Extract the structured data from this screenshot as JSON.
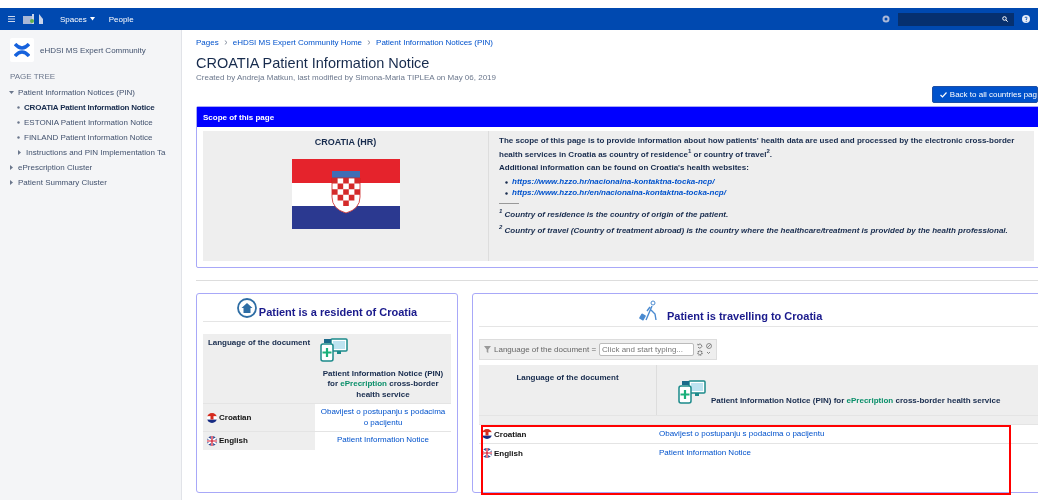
{
  "top_bar": {
    "nav": [
      {
        "label": "Spaces",
        "kind": "dropdown"
      },
      {
        "label": "People",
        "kind": "link"
      }
    ]
  },
  "sidebar": {
    "space_name": "eHDSI MS Expert Community",
    "section_title": "PAGE TREE",
    "tree": [
      {
        "label": "Patient Information Notices (PIN)",
        "kind": "folder",
        "expanded": true,
        "selected": false,
        "children": [
          {
            "label": "CROATIA Patient Information Notice",
            "kind": "page",
            "selected": true
          },
          {
            "label": "ESTONIA Patient Information Notice",
            "kind": "page",
            "selected": false
          },
          {
            "label": "FINLAND Patient Information Notice",
            "kind": "page",
            "selected": false
          },
          {
            "label": "Instructions and PIN Implementation Ta",
            "kind": "folder",
            "expanded": false,
            "selected": false
          }
        ]
      },
      {
        "label": "ePrescription Cluster",
        "kind": "folder",
        "expanded": false,
        "selected": false
      },
      {
        "label": "Patient Summary Cluster",
        "kind": "folder",
        "expanded": false,
        "selected": false
      }
    ]
  },
  "breadcrumbs": [
    "Pages",
    "eHDSI MS Expert Community Home",
    "Patient Information Notices (PIN)"
  ],
  "page_title": "CROATIA Patient Information Notice",
  "byline": "Created by Andreja Matkun, last modified by Simona-Maria TIPLEA on May 06, 2019",
  "back_button": "Back to all countries pag",
  "scope": {
    "header": "Scope of this page",
    "country": "CROATIA (HR)",
    "intro": "The scope of this page is to provide information about how patients' health data are used and processed by the electronic cross-border health services in Croatia as country of residence$^{1}$ or country of travel$^{2}$.",
    "links_heading": "Additional information can be found on Croatia's health websites:",
    "links": [
      "https://www.hzzo.hr/nacionalna-kontaktna-tocka-ncp/",
      "https://www.hzzo.hr/en/nacionalna-kontaktna-tocka-ncp/"
    ],
    "footnotes": [
      "$^{1}$ **Country of residence is the country of origin of the patient.**",
      "$^{2}$ **Country of travel** (Country of treatment abroad) is the country where the healthcare/treatment is provided by the health professional."
    ]
  },
  "resident": {
    "title": "Patient is a resident of Croatia",
    "column_1": "Language of the document",
    "pin_heading": [
      {
        "text": "Patient Information Notice (PIN) for ",
        "kind": "plain"
      },
      {
        "text": "ePrecription",
        "kind": "highlight"
      },
      {
        "text": " cross-border health service",
        "kind": "plain"
      }
    ],
    "rows": [
      {
        "language": "Croatian",
        "kind": "croatia",
        "document": "Obavijest o postupanju s podacima o pacijentu"
      },
      {
        "language": "English",
        "kind": "uk",
        "document": "Patient Information Notice"
      }
    ]
  },
  "travelling": {
    "title": "Patient is travelling to Croatia",
    "filter": {
      "label": "Language of the document =",
      "placeholder": "Click and start typing..."
    },
    "column_1": "Language of the document",
    "pin_heading": [
      {
        "text": "Patient Information Notice (PIN) for ",
        "kind": "plain"
      },
      {
        "text": "ePrecription",
        "kind": "highlight"
      },
      {
        "text": " cross-border health service",
        "kind": "plain"
      }
    ],
    "rows": [
      {
        "language": "Croatian",
        "kind": "croatia",
        "document": "Obavijest o postupanju s podacima o pacijentu"
      },
      {
        "language": "English",
        "kind": "uk",
        "document": "Patient Information Notice"
      }
    ]
  }
}
